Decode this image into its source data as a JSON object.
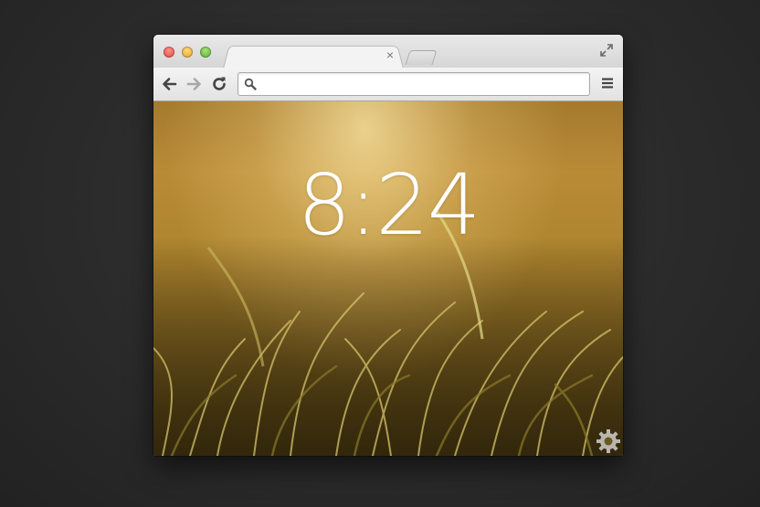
{
  "browser": {
    "tab": {
      "title": "",
      "close_label": "×"
    },
    "omnibox": {
      "value": "",
      "placeholder": ""
    }
  },
  "newtab_page": {
    "clock": "8:24"
  },
  "icons": {
    "close": "close-window-icon",
    "minimize": "minimize-window-icon",
    "zoom": "zoom-window-icon",
    "fullscreen": "fullscreen-icon",
    "back": "back-arrow-icon",
    "forward": "forward-arrow-icon",
    "reload": "reload-icon",
    "search": "search-icon",
    "menu": "hamburger-menu-icon",
    "settings": "gear-icon"
  },
  "colors": {
    "desktop_background": "#2b2b2b",
    "photo_tone": "#b98b37"
  }
}
